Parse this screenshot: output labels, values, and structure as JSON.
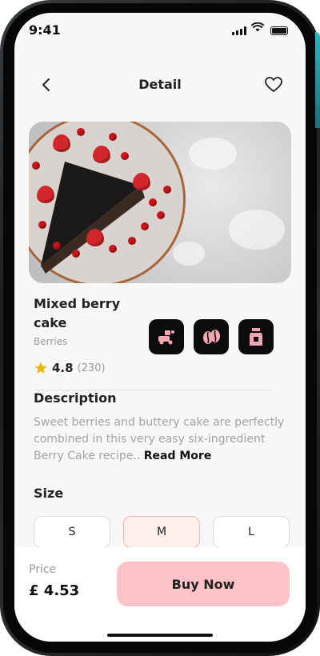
{
  "status_bar": {
    "time": "9:41"
  },
  "header": {
    "title": "Detail"
  },
  "product": {
    "name": "Mixed berry cake",
    "category": "Berries",
    "rating": "4.8",
    "rating_count": "(230)",
    "features": [
      "delivery-icon",
      "coffee-beans-icon",
      "milk-carton-icon"
    ]
  },
  "description": {
    "heading": "Description",
    "text": "Sweet berries and buttery cake are perfectly combined in this very easy six-ingredient Berry Cake recipe..",
    "read_more": "Read More"
  },
  "size": {
    "heading": "Size",
    "options": [
      "S",
      "M",
      "L"
    ],
    "selected": "M"
  },
  "footer": {
    "price_label": "Price",
    "price": "£ 4.53",
    "buy_label": "Buy Now"
  },
  "colors": {
    "accent": "#ffc3c7",
    "selected_bg": "#fcefec",
    "selected_border": "#f3b6b3",
    "icon_tile": "#0b0b0b",
    "icon_glyph": "#f4a7b2",
    "star": "#f4b400"
  }
}
